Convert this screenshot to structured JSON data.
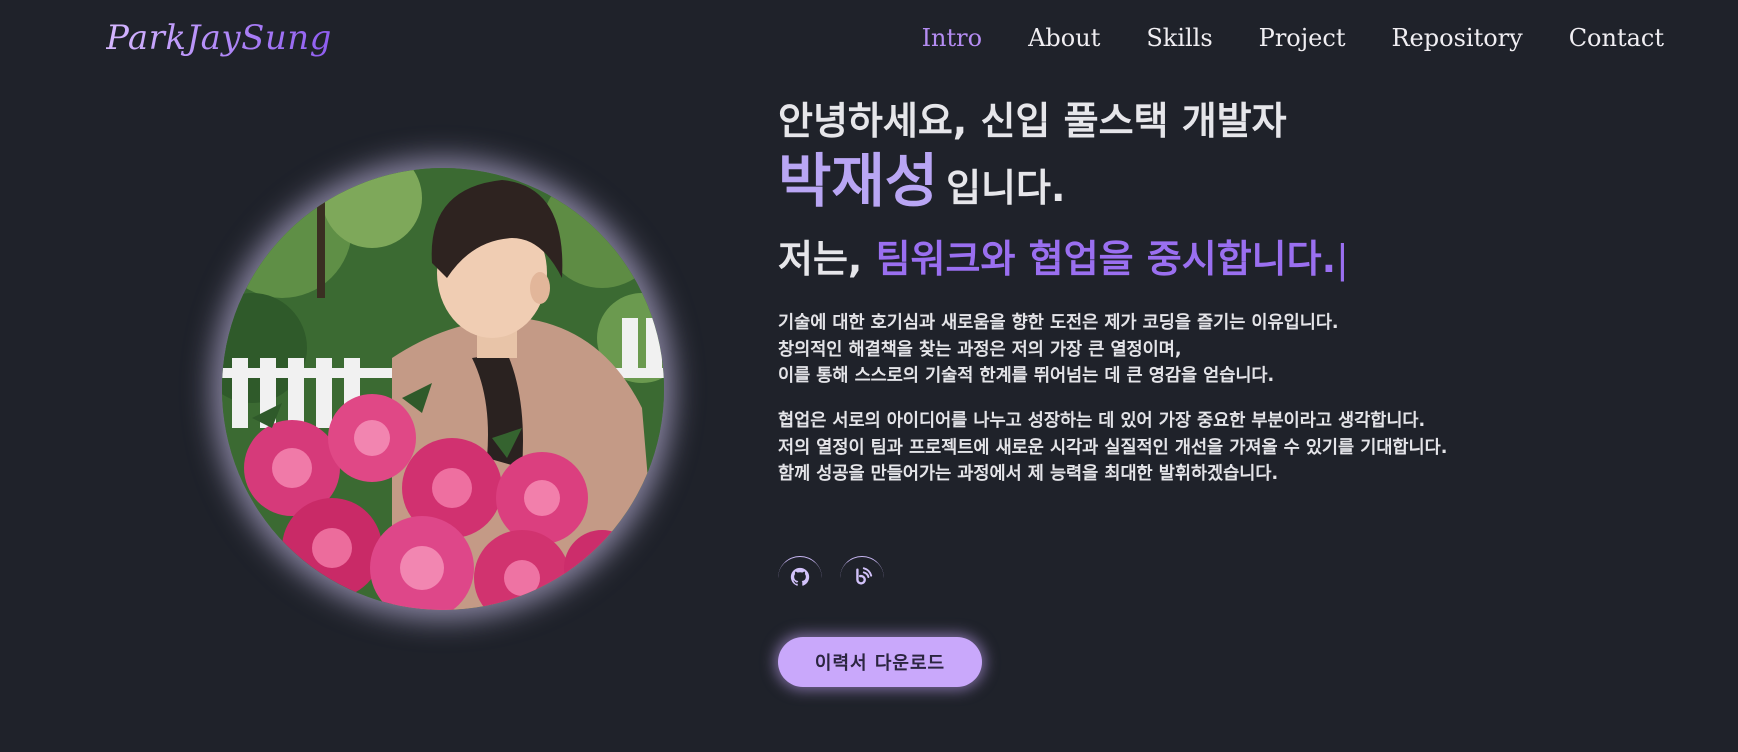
{
  "header": {
    "logo": "ParkJaySung",
    "nav": [
      {
        "label": "Intro",
        "active": true
      },
      {
        "label": "About",
        "active": false
      },
      {
        "label": "Skills",
        "active": false
      },
      {
        "label": "Project",
        "active": false
      },
      {
        "label": "Repository",
        "active": false
      },
      {
        "label": "Contact",
        "active": false
      }
    ]
  },
  "hero": {
    "greeting": "안녕하세요, 신입 풀스택 개발자",
    "name": "박재성",
    "name_suffix": "입니다.",
    "motto_lead": "저는, ",
    "motto_highlight": "팀워크와 협업을 중시합니다.",
    "cursor": "|",
    "paragraph1": [
      "기술에 대한 호기심과 새로움을 향한 도전은 제가 코딩을 즐기는 이유입니다.",
      "창의적인 해결책을 찾는 과정은 저의 가장 큰 열정이며,",
      "이를 통해 스스로의 기술적 한계를 뛰어넘는 데 큰 영감을 얻습니다."
    ],
    "paragraph2": [
      "협업은 서로의 아이디어를 나누고 성장하는 데 있어 가장 중요한 부분이라고 생각합니다.",
      "저의 열정이 팀과 프로젝트에 새로운 시각과 실질적인 개선을 가져올 수 있기를 기대합니다.",
      "함께 성공을 만들어가는 과정에서 제 능력을 최대한 발휘하겠습니다."
    ],
    "resume_button": "이력서 다운로드"
  },
  "socials": [
    {
      "icon": "github-icon"
    },
    {
      "icon": "blog-icon"
    }
  ],
  "colors": {
    "background": "#1f222a",
    "accent": "#9a6ff0",
    "accent_light": "#b9a6f4",
    "button": "#c9a8fb"
  }
}
